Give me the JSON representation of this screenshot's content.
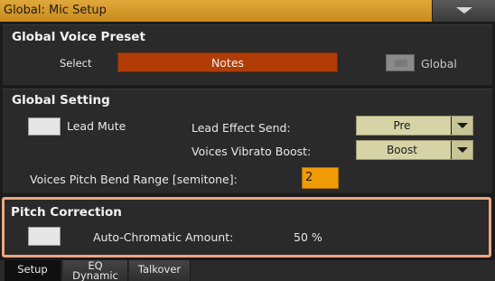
{
  "window": {
    "title": "Global: Mic Setup",
    "menu_icon": "triangle-down-icon"
  },
  "voice_preset": {
    "title": "Global Voice Preset",
    "select_label": "Select",
    "select_value": "Notes",
    "global_label": "Global"
  },
  "global_setting": {
    "title": "Global Setting",
    "lead_mute_label": "Lead Mute",
    "lead_effect_label": "Lead Effect Send:",
    "lead_effect_value": "Pre",
    "vibrato_label": "Voices Vibrato Boost:",
    "vibrato_value": "Boost",
    "pitch_bend_label": "Voices Pitch Bend Range [semitone]:",
    "pitch_bend_value": "2"
  },
  "pitch_correction": {
    "title": "Pitch Correction",
    "amount_label": "Auto-Chromatic Amount:",
    "amount_value": "50 %"
  },
  "tabs": [
    {
      "line1": "Setup",
      "line2": ""
    },
    {
      "line1": "EQ",
      "line2": "Dynamic"
    },
    {
      "line1": "Talkover",
      "line2": ""
    }
  ],
  "colors": {
    "title_bar": "#d99a2a",
    "selector": "#b03d06",
    "dropdown": "#d6d4a6",
    "number_box": "#f09a06",
    "highlight_border": "#f0a580"
  }
}
